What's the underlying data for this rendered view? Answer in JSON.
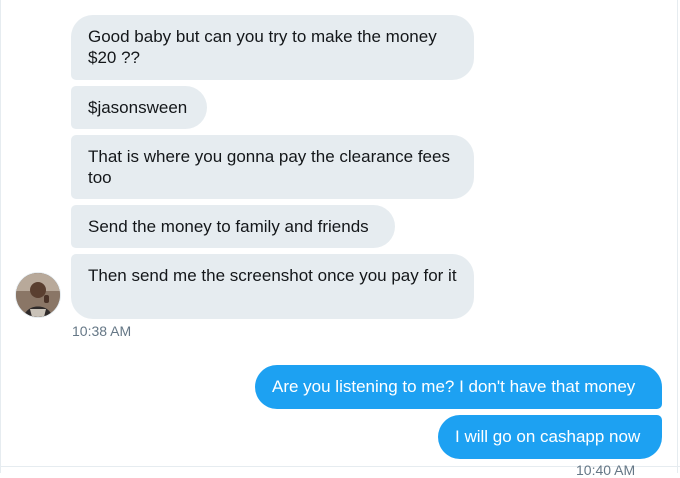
{
  "conversation": {
    "incoming": [
      {
        "text": "Good baby but can you try to make the money $20 ??"
      },
      {
        "text": "$jasonsween"
      },
      {
        "text": "That is where you gonna pay the clearance fees too"
      },
      {
        "text": "Send the money to family and friends"
      },
      {
        "text": "Then send me the screenshot once you pay for it"
      }
    ],
    "incoming_timestamp": "10:38 AM",
    "outgoing": [
      {
        "text": "Are you listening to me? I don't have that money"
      },
      {
        "text": "I will go on cashapp now"
      }
    ],
    "outgoing_timestamp": "10:40 AM"
  },
  "colors": {
    "incoming_bubble": "#e6ecf0",
    "outgoing_bubble": "#1da1f2",
    "timestamp": "#657786"
  }
}
